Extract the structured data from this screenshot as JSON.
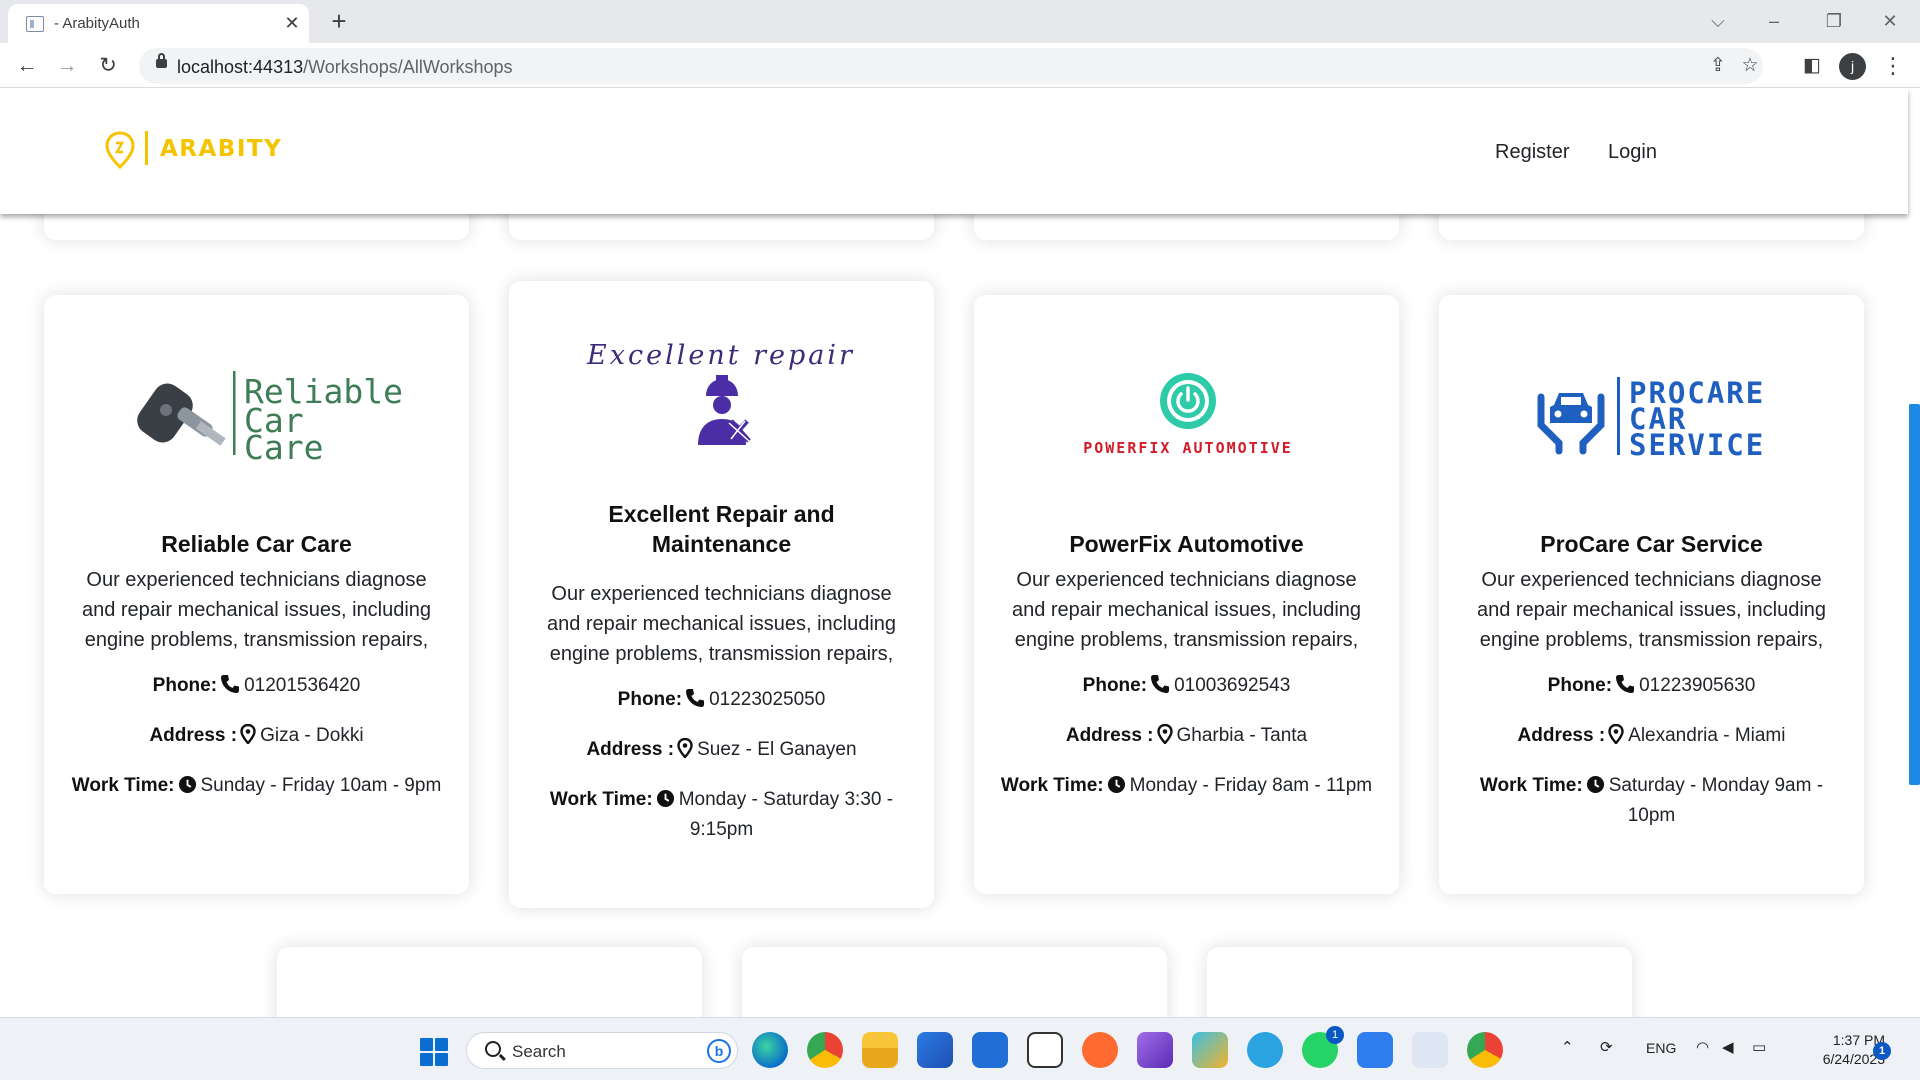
{
  "browser": {
    "tab_title": "- ArabityAuth",
    "tab_close": "✕",
    "new_tab": "+",
    "url_host": "localhost:44313",
    "url_path": "/Workshops/AllWorkshops",
    "profile_initial": "j"
  },
  "site": {
    "brand": "ARABITY",
    "brand_color": "#f5c400",
    "nav": {
      "register": "Register",
      "login": "Login"
    }
  },
  "cards": [
    {
      "logo_text": [
        "Reliable",
        "Car",
        "Care"
      ],
      "name": "Reliable Car Care",
      "description": "Our experienced technicians diagnose and repair mechanical issues, including engine problems, transmission repairs,",
      "phone_label": "Phone:",
      "phone": "01201536420",
      "address_label": "Address :",
      "address": "Giza - Dokki",
      "worktime_label": "Work Time:",
      "worktime": "Sunday - Friday 10am - 9pm"
    },
    {
      "logo_text": [
        "Excellent repair"
      ],
      "name": "Excellent Repair and Maintenance",
      "description": "Our experienced technicians diagnose and repair mechanical issues, including engine problems, transmission repairs,",
      "phone_label": "Phone:",
      "phone": "01223025050",
      "address_label": "Address :",
      "address": "Suez - El Ganayen",
      "worktime_label": "Work Time:",
      "worktime": "Monday - Saturday 3:30 - 9:15pm"
    },
    {
      "logo_text": [
        "POWERFIX AUTOMOTIVE"
      ],
      "name": "PowerFix Automotive",
      "description": "Our experienced technicians diagnose and repair mechanical issues, including engine problems, transmission repairs,",
      "phone_label": "Phone:",
      "phone": "01003692543",
      "address_label": "Address :",
      "address": "Gharbia - Tanta",
      "worktime_label": "Work Time:",
      "worktime": "Monday - Friday 8am - 11pm"
    },
    {
      "logo_text": [
        "PROCARE",
        "CAR",
        "SERVICE"
      ],
      "name": "ProCare Car Service",
      "description": "Our experienced technicians diagnose and repair mechanical issues, including engine problems, transmission repairs,",
      "phone_label": "Phone:",
      "phone": "01223905630",
      "address_label": "Address :",
      "address": "Alexandria - Miami",
      "worktime_label": "Work Time:",
      "worktime": "Saturday - Monday 9am - 10pm"
    }
  ],
  "taskbar": {
    "search_placeholder": "Search",
    "whatsapp_badge": "1",
    "language": "ENG",
    "time": "1:37 PM",
    "date": "6/24/2023",
    "notification_count": "1"
  }
}
